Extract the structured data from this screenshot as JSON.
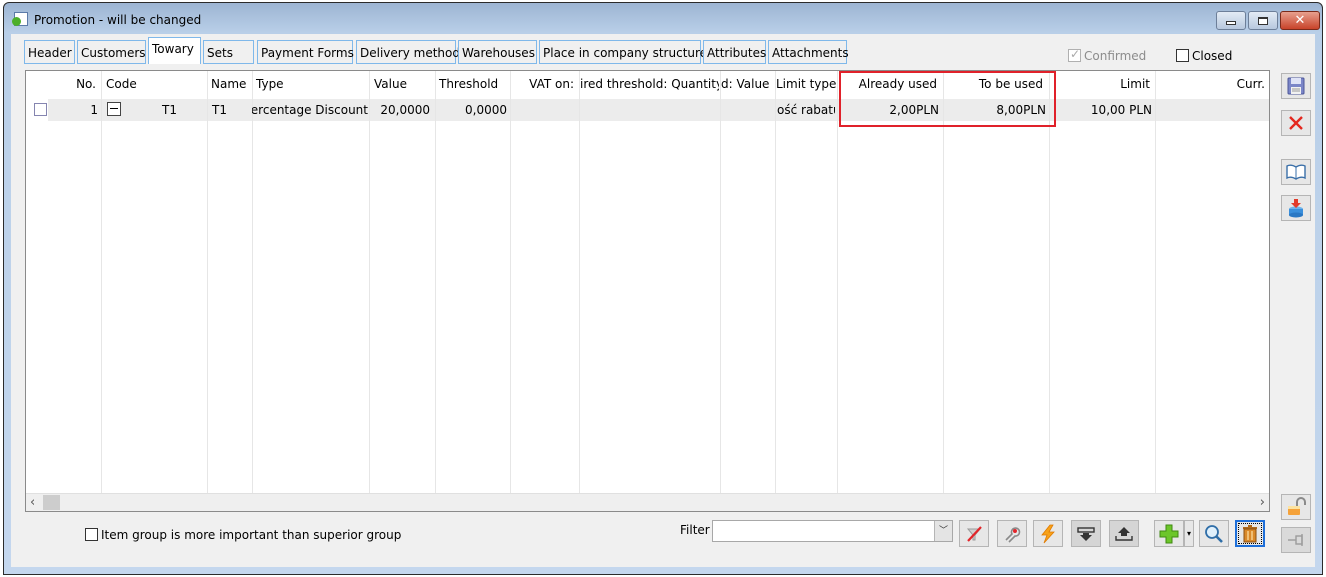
{
  "window": {
    "title": "Promotion - will be changed",
    "icon": "promotion-app-icon",
    "controls": {
      "minimize": "minimize-icon",
      "maximize": "maximize-icon",
      "close": "✕"
    }
  },
  "tabs": [
    {
      "label": "Header",
      "active": false
    },
    {
      "label": "Customers",
      "active": false
    },
    {
      "label": "Towary",
      "active": true
    },
    {
      "label": "Sets",
      "active": false
    },
    {
      "label": "Payment Forms",
      "active": false
    },
    {
      "label": "Delivery method",
      "active": false
    },
    {
      "label": "Warehouses",
      "active": false
    },
    {
      "label": "Place in company structure",
      "active": false
    },
    {
      "label": "Attributes",
      "active": false
    },
    {
      "label": "Attachments",
      "active": false
    }
  ],
  "status": {
    "confirmed": {
      "label": "Confirmed",
      "checked": true,
      "enabled": false
    },
    "closed": {
      "label": "Closed",
      "checked": false
    }
  },
  "grid": {
    "columns": [
      "No.",
      "Code",
      "Name",
      "Type",
      "Value",
      "Threshold",
      "VAT on:",
      "ired threshold: Quantity",
      "d: Value",
      "Limit type",
      "Already used",
      "To be used",
      "Limit",
      "Curr."
    ],
    "rows": [
      {
        "no": "1",
        "code": "T1",
        "name": "T1",
        "type": "Percentage Discount",
        "value": "20,0000",
        "threshold": "0,0000",
        "vat_on": "",
        "req_threshold_quantity": "",
        "req_threshold_value": "",
        "limit_type": "ość rabatu",
        "already_used": "2,00PLN",
        "to_be_used": "8,00PLN",
        "limit": "10,00 PLN",
        "currency": ""
      }
    ],
    "highlighted_columns": [
      "Already used",
      "To be used"
    ],
    "highlight_color": "#e0212a"
  },
  "footer": {
    "item_group_checkbox": {
      "label": "Item group is more important than superior group",
      "checked": false
    },
    "filter": {
      "label": "Filter",
      "value": "",
      "placeholder": ""
    }
  },
  "toolbar": {
    "buttons": [
      "clear-filter-icon",
      "filter-settings-icon",
      "lightning-icon",
      "import-down-icon",
      "export-up-icon",
      "add-plus-icon",
      "dropdown-arrow",
      "search-magnifier-icon",
      "trash-bin-icon"
    ]
  },
  "side_toolbar": {
    "buttons": [
      "save-icon",
      "cancel-x-icon",
      "book-icon",
      "database-import-icon",
      "unlock-padlock-icon",
      "pin-icon"
    ]
  }
}
